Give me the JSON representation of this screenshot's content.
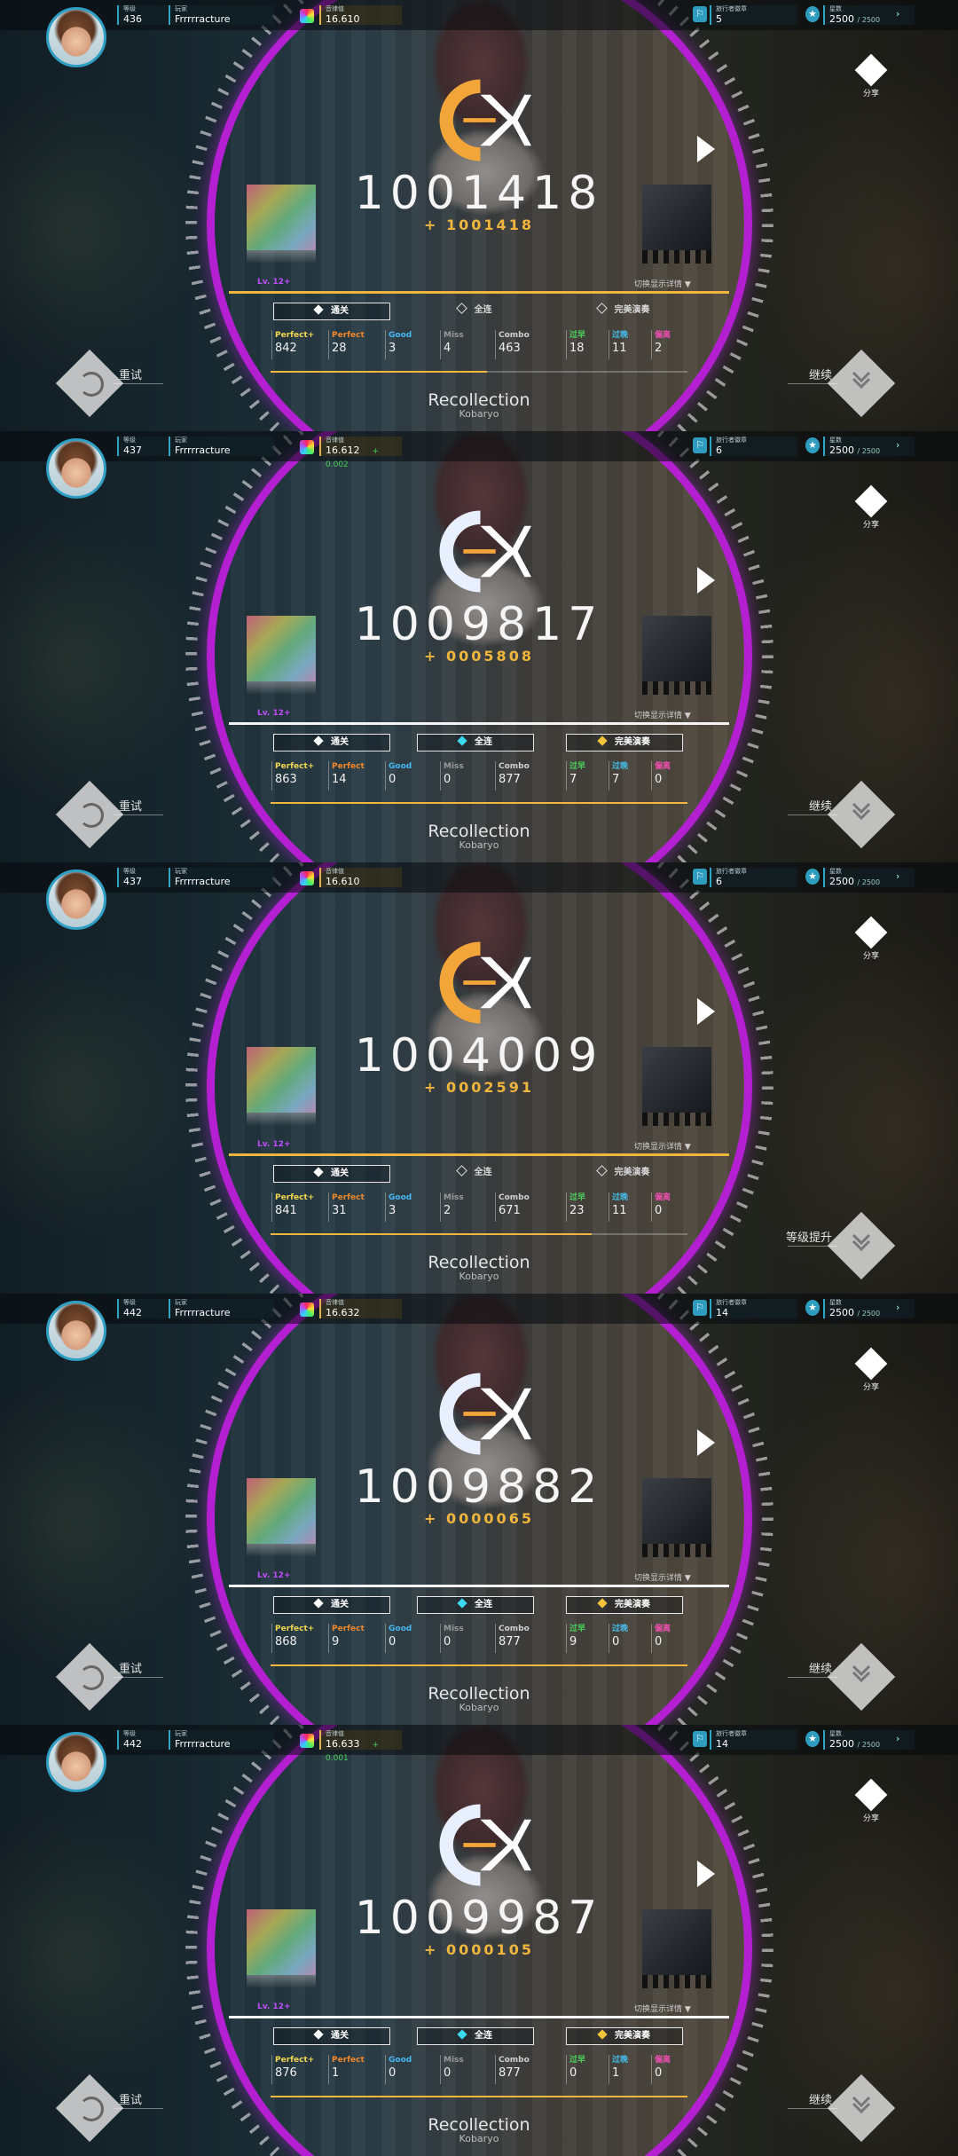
{
  "colors": {
    "ring": "#b41fd2",
    "accent_blue": "#2ea6c6",
    "gold": "#f0b53d",
    "perfect_plus": "#f2d650",
    "perfect": "#f0872a",
    "good": "#47b6f0",
    "miss": "#9a9a9a",
    "early": "#4bd05b",
    "late": "#45c0ef",
    "offset": "#f04fb0"
  },
  "icons": [
    "avatar",
    "rating-hex-icon",
    "explorer-icon",
    "star-icon",
    "share-icon",
    "play-icon",
    "retry-icon",
    "continue-icon",
    "chevron-right-icon"
  ],
  "labels": {
    "level": "等级",
    "player": "玩家",
    "rating": "音律值",
    "explorer": "旅行者徽章",
    "stars": "星数",
    "share": "分享",
    "switch": "切换显示详情 ▼",
    "badge_clear": "通关",
    "badge_fc": "全连",
    "badge_ap": "完美演奏",
    "pp": "Perfect+",
    "p": "Perfect",
    "g": "Good",
    "m": "Miss",
    "c": "Combo",
    "early": "过早",
    "late": "过晚",
    "offset": "偏离"
  },
  "panels": [
    {
      "level_value": "436",
      "player": "Frrrrracture",
      "rating": "16.610",
      "rating_delta": "",
      "explorer_value": "5",
      "stars": "2500",
      "stars_max": "/ 2500",
      "score": "1001418",
      "score_delta": "+ 1001418",
      "diff": "Lv. 12+",
      "fc": false,
      "ap": false,
      "perfect_plus": "842",
      "perfect": "28",
      "good": "3",
      "miss": "4",
      "combo": "463",
      "early": "18",
      "late": "11",
      "offset": "2",
      "progress": 0.52,
      "song": "Recollection",
      "artist": "Kobaryo",
      "left_label": "重试",
      "right_label": "继续",
      "left_visible": true
    },
    {
      "level_value": "437",
      "player": "Frrrrracture",
      "rating": "16.612",
      "rating_delta": "+ 0.002",
      "explorer_value": "6",
      "stars": "2500",
      "stars_max": "/ 2500",
      "score": "1009817",
      "score_delta": "+ 0005808",
      "diff": "Lv. 12+",
      "fc": true,
      "ap": true,
      "perfect_plus": "863",
      "perfect": "14",
      "good": "0",
      "miss": "0",
      "combo": "877",
      "early": "7",
      "late": "7",
      "offset": "0",
      "progress": 1,
      "song": "Recollection",
      "artist": "Kobaryo",
      "left_label": "重试",
      "right_label": "继续",
      "left_visible": true
    },
    {
      "level_value": "437",
      "player": "Frrrrracture",
      "rating": "16.610",
      "rating_delta": "",
      "explorer_value": "6",
      "stars": "2500",
      "stars_max": "/ 2500",
      "score": "1004009",
      "score_delta": "+ 0002591",
      "diff": "Lv. 12+",
      "fc": false,
      "ap": false,
      "perfect_plus": "841",
      "perfect": "31",
      "good": "3",
      "miss": "2",
      "combo": "671",
      "early": "23",
      "late": "11",
      "offset": "0",
      "progress": 0.77,
      "song": "Recollection",
      "artist": "Kobaryo",
      "left_label": "",
      "right_label": "等级提升",
      "left_visible": false
    },
    {
      "level_value": "442",
      "player": "Frrrrracture",
      "rating": "16.632",
      "rating_delta": "",
      "explorer_value": "14",
      "stars": "2500",
      "stars_max": "/ 2500",
      "score": "1009882",
      "score_delta": "+ 0000065",
      "diff": "Lv. 12+",
      "fc": true,
      "ap": true,
      "perfect_plus": "868",
      "perfect": "9",
      "good": "0",
      "miss": "0",
      "combo": "877",
      "early": "9",
      "late": "0",
      "offset": "0",
      "progress": 1,
      "song": "Recollection",
      "artist": "Kobaryo",
      "left_label": "重试",
      "right_label": "继续",
      "left_visible": true
    },
    {
      "level_value": "442",
      "player": "Frrrrracture",
      "rating": "16.633",
      "rating_delta": "+ 0.001",
      "explorer_value": "14",
      "stars": "2500",
      "stars_max": "/ 2500",
      "score": "1009987",
      "score_delta": "+ 0000105",
      "diff": "Lv. 12+",
      "fc": true,
      "ap": true,
      "perfect_plus": "876",
      "perfect": "1",
      "good": "0",
      "miss": "0",
      "combo": "877",
      "early": "0",
      "late": "1",
      "offset": "0",
      "progress": 1,
      "song": "Recollection",
      "artist": "Kobaryo",
      "left_label": "重试",
      "right_label": "继续",
      "left_visible": true
    }
  ]
}
